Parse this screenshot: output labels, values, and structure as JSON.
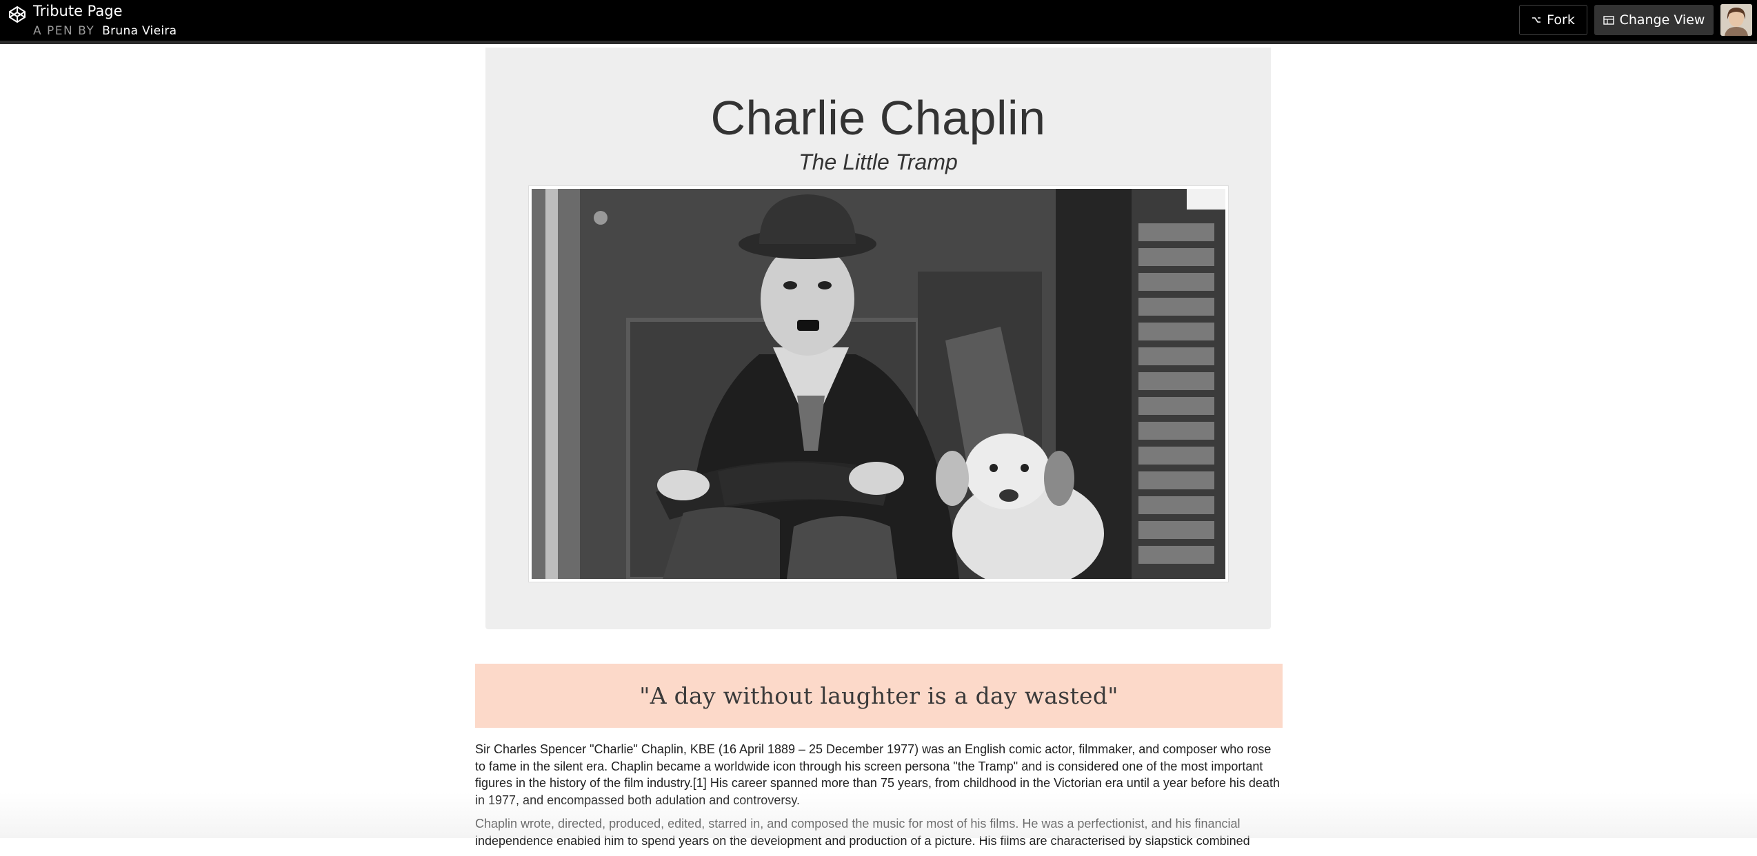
{
  "header": {
    "pen_title": "Tribute Page",
    "pen_by_label": "A PEN BY",
    "author": "Bruna Vieira",
    "fork_label": "Fork",
    "change_view_label": "Change View"
  },
  "hero": {
    "title": "Charlie Chaplin",
    "subtitle": "The Little Tramp"
  },
  "quote": "\"A day without laughter is a day wasted\"",
  "bio": {
    "paragraphs": [
      "Sir Charles Spencer \"Charlie\" Chaplin, KBE (16 April 1889 – 25 December 1977) was an English comic actor, filmmaker, and composer who rose to fame in the silent era. Chaplin became a worldwide icon through his screen persona \"the Tramp\" and is considered one of the most important figures in the history of the film industry.[1] His career spanned more than 75 years, from childhood in the Victorian era until a year before his death in 1977, and encompassed both adulation and controversy.",
      "Chaplin wrote, directed, produced, edited, starred in, and composed the music for most of his films. He was a perfectionist, and his financial independence enabled him to spend years on the development and production of a picture. His films are characterised by slapstick combined"
    ]
  },
  "colors": {
    "topbar": "#000000",
    "hero_bg": "#eeeeee",
    "quote_bg": "#fcd9c9",
    "text": "#333333"
  },
  "icons": {
    "logo": "codepen-logo-icon",
    "fork": "fork-icon",
    "change_view": "layout-icon"
  }
}
